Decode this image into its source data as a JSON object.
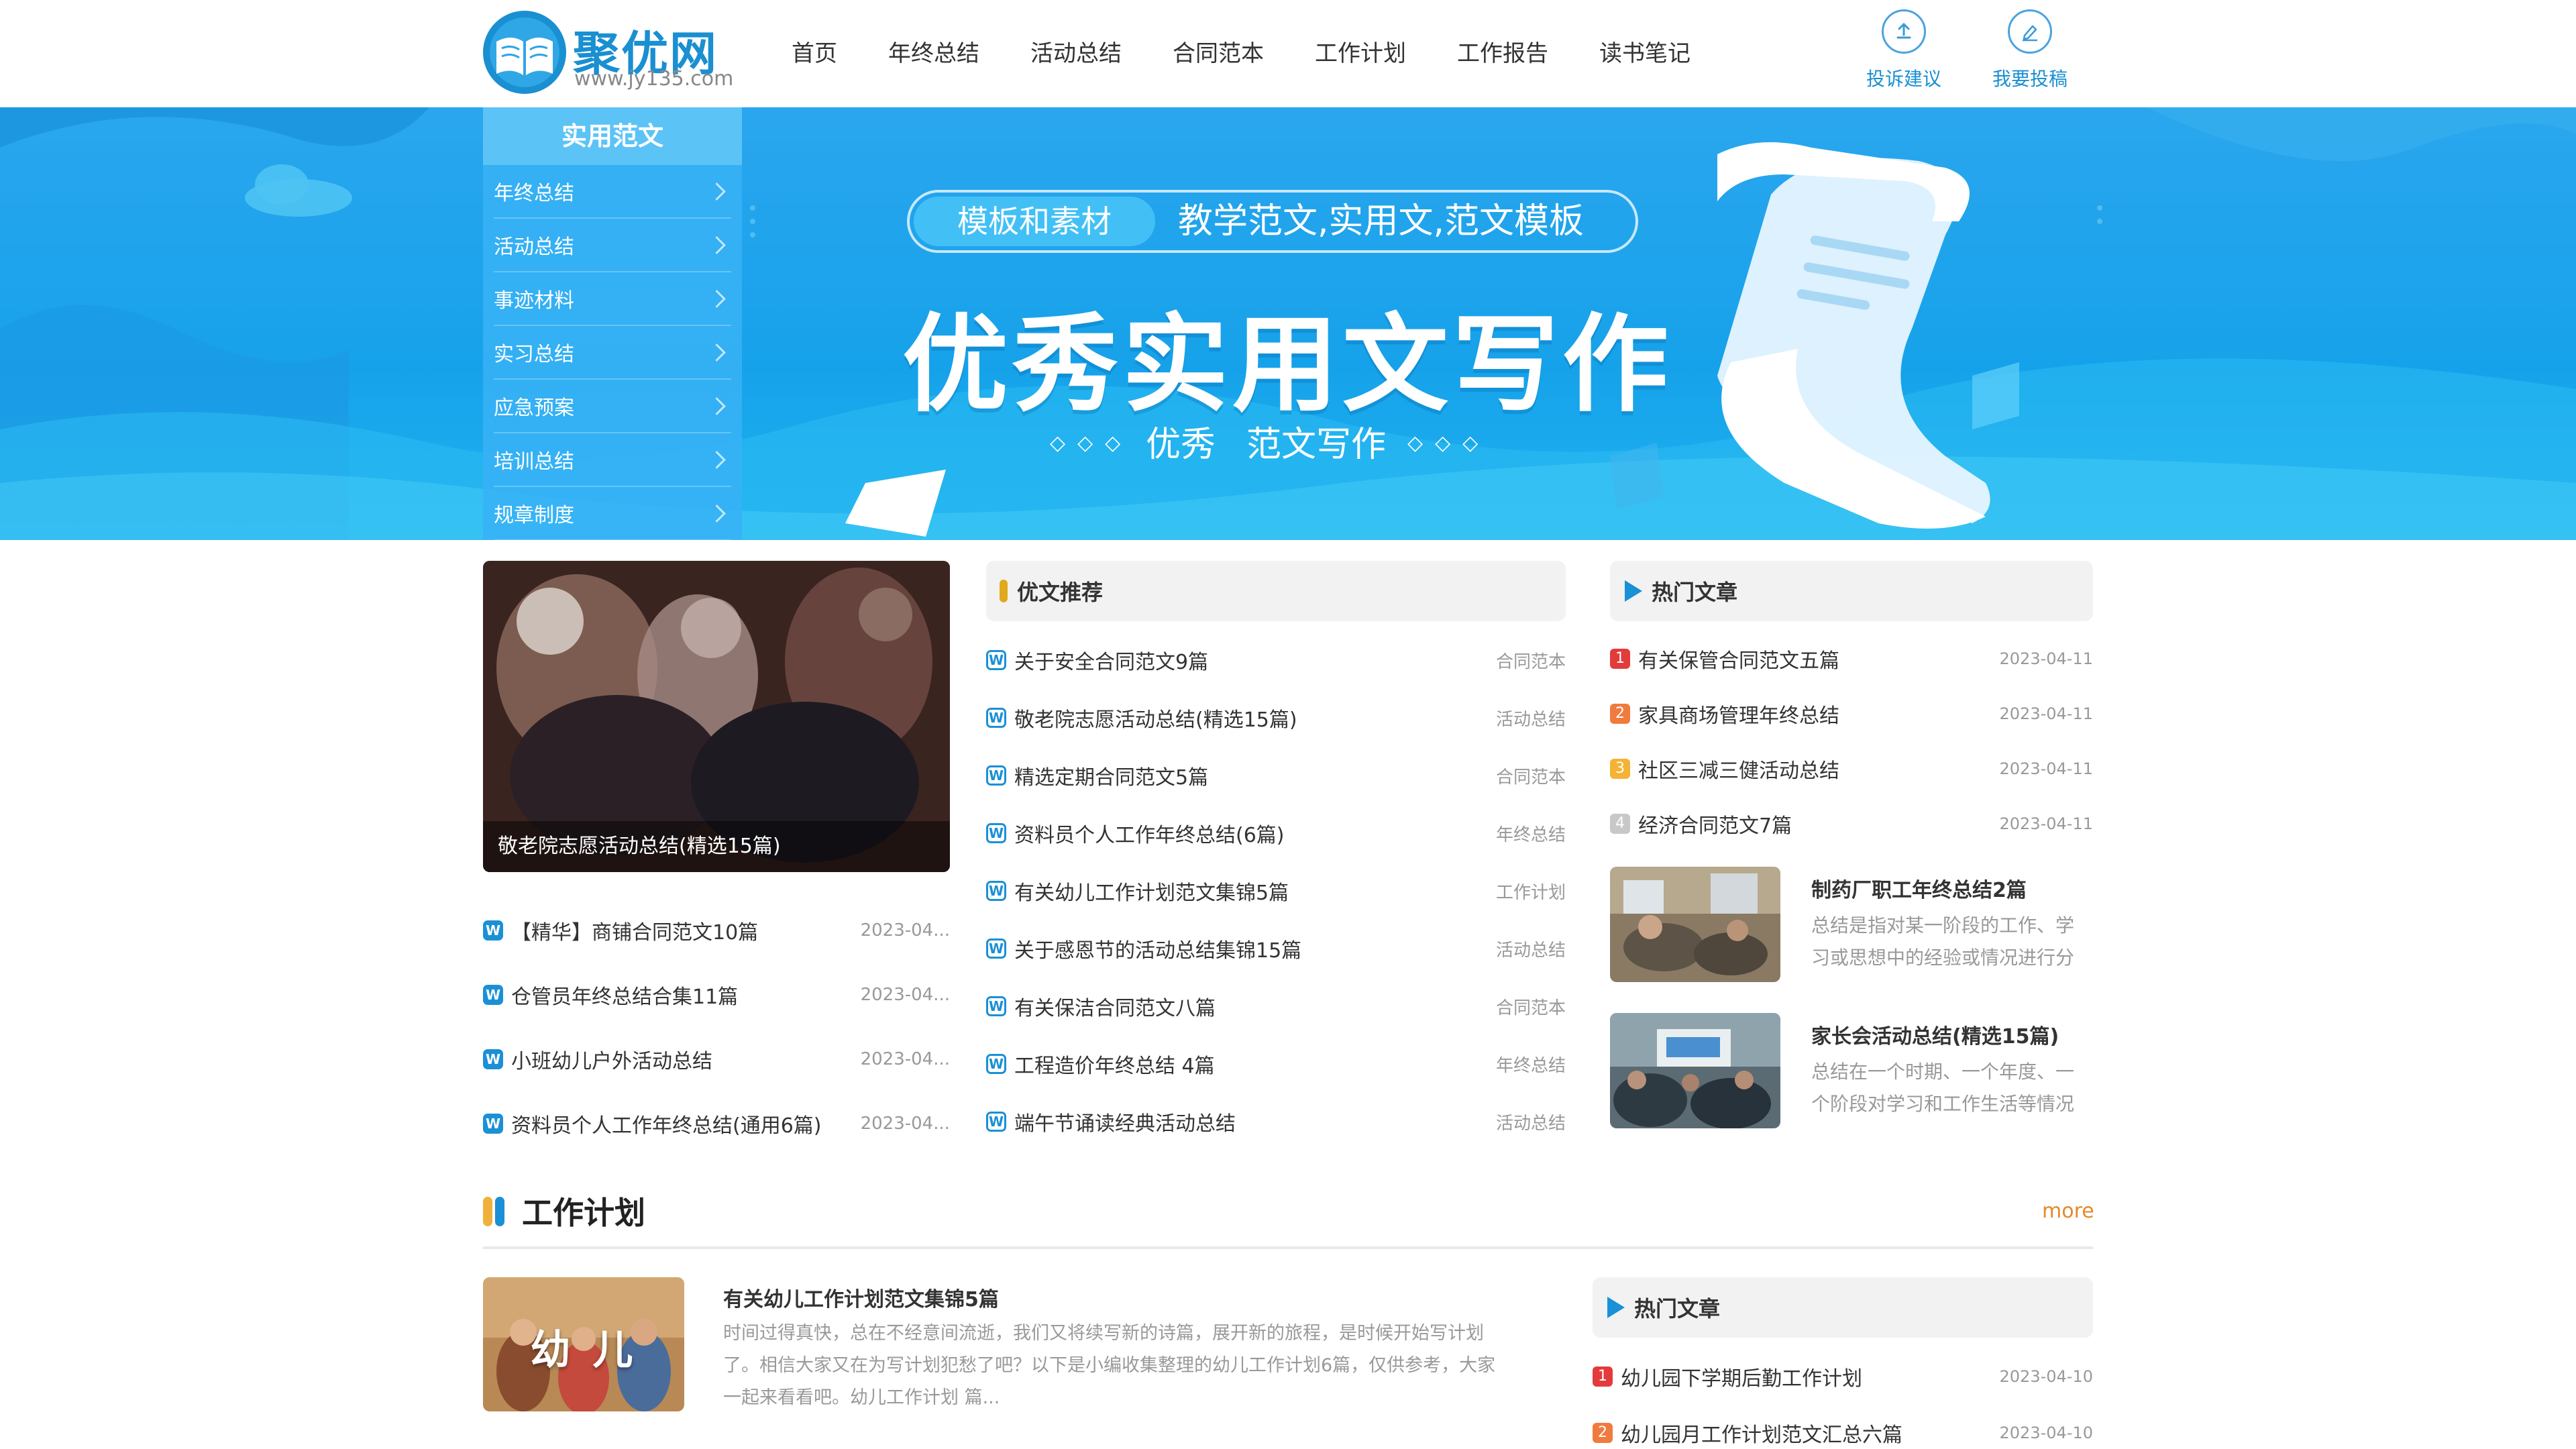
{
  "logo": {
    "name": "聚优网",
    "url": "www.jy135.com"
  },
  "nav": [
    "首页",
    "年终总结",
    "活动总结",
    "合同范本",
    "工作计划",
    "工作报告",
    "读书笔记"
  ],
  "header_actions": {
    "complaint": "投诉建议",
    "submit": "我要投稿"
  },
  "banner": {
    "pill_left": "模板和素材",
    "pill_right": "教学范文,实用文,范文模板",
    "headline": "优秀实用文写作",
    "sub_left": "优秀",
    "sub_right": "范文写作"
  },
  "side_menu": {
    "title": "实用范文",
    "items": [
      "年终总结",
      "活动总结",
      "事迹材料",
      "实习总结",
      "应急预案",
      "培训总结",
      "规章制度"
    ]
  },
  "feature": {
    "caption": "敬老院志愿活动总结(精选15篇)",
    "list": [
      {
        "title": "【精华】商铺合同范文10篇",
        "date": "2023-04..."
      },
      {
        "title": "仓管员年终总结合集11篇",
        "date": "2023-04..."
      },
      {
        "title": "小班幼儿户外活动总结",
        "date": "2023-04..."
      },
      {
        "title": "资料员个人工作年终总结(通用6篇)",
        "date": "2023-04..."
      }
    ]
  },
  "recommend": {
    "title": "优文推荐",
    "items": [
      {
        "title": "关于安全合同范文9篇",
        "cat": "合同范本"
      },
      {
        "title": "敬老院志愿活动总结(精选15篇)",
        "cat": "活动总结"
      },
      {
        "title": "精选定期合同范文5篇",
        "cat": "合同范本"
      },
      {
        "title": "资料员个人工作年终总结(6篇)",
        "cat": "年终总结"
      },
      {
        "title": "有关幼儿工作计划范文集锦5篇",
        "cat": "工作计划"
      },
      {
        "title": "关于感恩节的活动总结集锦15篇",
        "cat": "活动总结"
      },
      {
        "title": "有关保洁合同范文八篇",
        "cat": "合同范本"
      },
      {
        "title": "工程造价年终总结 4篇",
        "cat": "年终总结"
      },
      {
        "title": "端午节诵读经典活动总结",
        "cat": "活动总结"
      }
    ]
  },
  "hot": {
    "title": "热门文章",
    "items": [
      {
        "num": "1",
        "title": "有关保管合同范文五篇",
        "date": "2023-04-11"
      },
      {
        "num": "2",
        "title": "家具商场管理年终总结",
        "date": "2023-04-11"
      },
      {
        "num": "3",
        "title": "社区三减三健活动总结",
        "date": "2023-04-11"
      },
      {
        "num": "4",
        "title": "经济合同范文7篇",
        "date": "2023-04-11"
      }
    ],
    "cards": [
      {
        "title": "制药厂职工年终总结2篇",
        "desc1": "总结是指对某一阶段的工作、学",
        "desc2": "习或思想中的经验或情况进行分"
      },
      {
        "title": "家长会活动总结(精选15篇)",
        "desc1": "总结在一个时期、一个年度、一",
        "desc2": "个阶段对学习和工作生活等情况"
      }
    ]
  },
  "section": {
    "title": "工作计划",
    "more": "more",
    "article": {
      "thumb_text": "幼 儿",
      "title": "有关幼儿工作计划范文集锦5篇",
      "desc1": "时间过得真快，总在不经意间流逝，我们又将续写新的诗篇，展开新的旅程，是时候开始写计划",
      "desc2": "了。相信大家又在为写计划犯愁了吧？以下是小编收集整理的幼儿工作计划6篇，仅供参考，大家",
      "desc3": "一起来看看吧。幼儿工作计划 篇..."
    },
    "hot": {
      "title": "热门文章",
      "items": [
        {
          "num": "1",
          "title": "幼儿园下学期后勤工作计划",
          "date": "2023-04-10"
        },
        {
          "num": "2",
          "title": "幼儿园月工作计划范文汇总六篇",
          "date": "2023-04-10"
        }
      ]
    }
  },
  "colors": {
    "brand": "#1a8fd1",
    "banner": "#16a2ea",
    "more": "#e58a2a",
    "rank1": "#e33b3b",
    "rank2": "#f07b3f",
    "rank3": "#f5b335",
    "rank4": "#c8c8c8"
  },
  "icons": {
    "upload": "upload-icon",
    "edit": "edit-icon",
    "triangle": "play-triangle-icon",
    "doc": "word-doc-icon"
  }
}
